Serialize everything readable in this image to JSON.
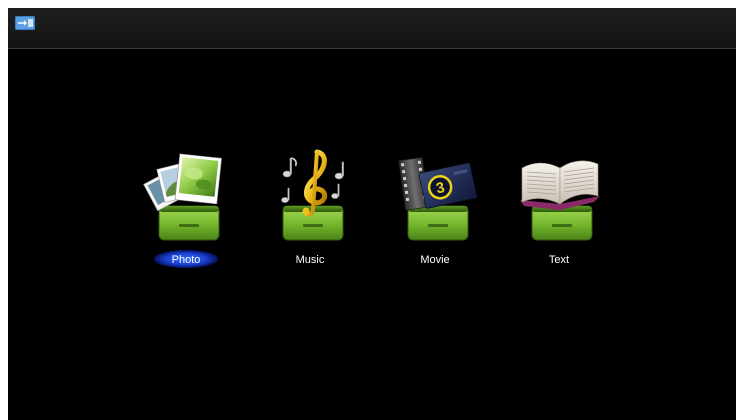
{
  "status_bar": {
    "icon": "usb-storage-icon"
  },
  "menu": {
    "selected_index": 0,
    "highlight_color": "#2d6cff",
    "tray_color": "#7ac23a",
    "items": [
      {
        "label": "Photo",
        "icon": "photo-stack-icon",
        "selected": true
      },
      {
        "label": "Music",
        "icon": "music-note-icon",
        "selected": false
      },
      {
        "label": "Movie",
        "icon": "film-reel-icon",
        "selected": false
      },
      {
        "label": "Text",
        "icon": "open-book-icon",
        "selected": false
      }
    ]
  },
  "movie_badge": "3"
}
